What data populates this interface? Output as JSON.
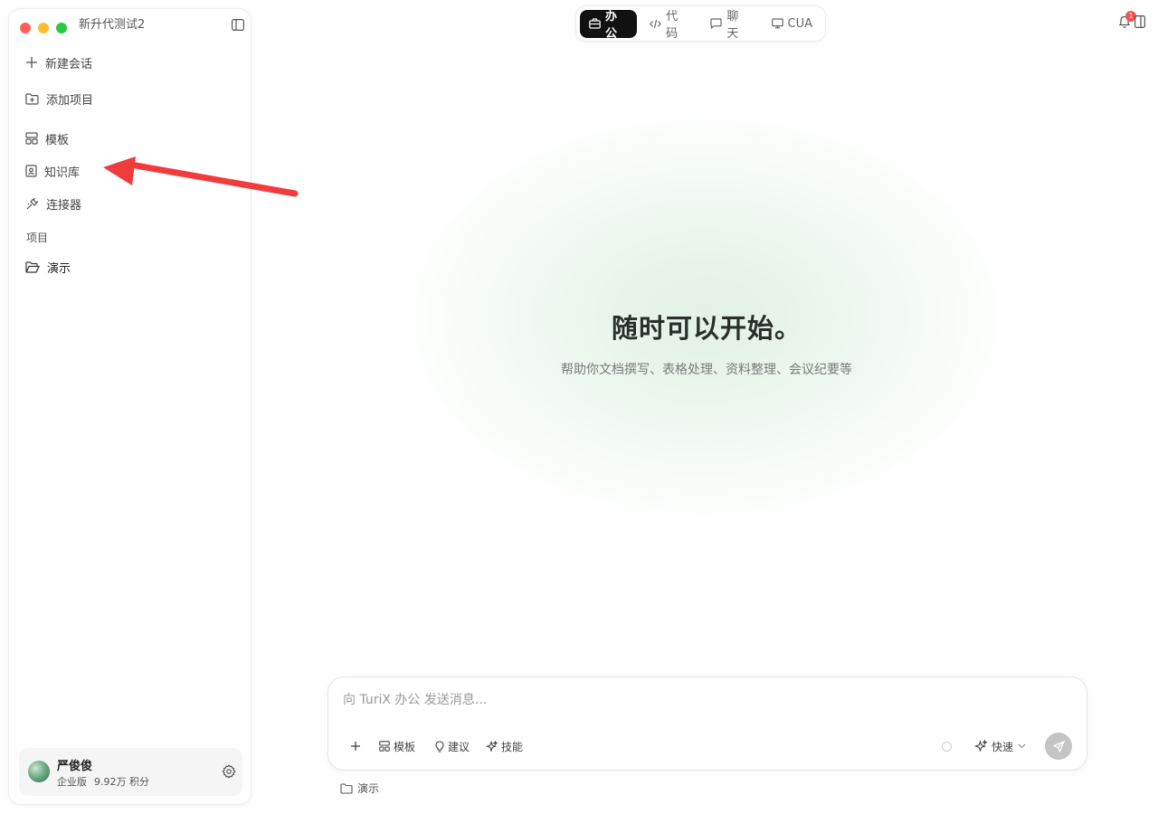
{
  "window": {
    "title": "新升代测试2"
  },
  "sidebar": {
    "items": [
      {
        "label": "新建会话",
        "icon": "plus-icon"
      },
      {
        "label": "添加项目",
        "icon": "folder-plus-icon"
      },
      {
        "label": "模板",
        "icon": "template-icon"
      },
      {
        "label": "知识库",
        "icon": "book-icon"
      },
      {
        "label": "连接器",
        "icon": "plug-icon"
      }
    ],
    "section_label": "项目",
    "projects": [
      {
        "label": "演示",
        "icon": "folder-open-icon"
      }
    ]
  },
  "user": {
    "name": "严俊俊",
    "plan": "企业版",
    "credits": "9.92万 积分"
  },
  "modes": [
    {
      "label": "办公",
      "icon": "briefcase-icon",
      "active": true
    },
    {
      "label": "代码",
      "icon": "code-icon",
      "active": false
    },
    {
      "label": "聊天",
      "icon": "chat-icon",
      "active": false
    },
    {
      "label": "CUA",
      "icon": "monitor-icon",
      "active": false
    }
  ],
  "notifications": {
    "count": "1"
  },
  "hero": {
    "title": "随时可以开始。",
    "subtitle": "帮助你文档撰写、表格处理、资料整理、会议纪要等"
  },
  "composer": {
    "placeholder": "向 TuriX 办公 发送消息...",
    "value": "",
    "tools": [
      {
        "label": "",
        "icon": "plus-icon"
      },
      {
        "label": "模板",
        "icon": "template-icon"
      },
      {
        "label": "建议",
        "icon": "bulb-icon"
      },
      {
        "label": "技能",
        "icon": "sparkle-icon"
      }
    ],
    "speed_label": "快速"
  },
  "project_chip": {
    "label": "演示"
  },
  "colors": {
    "accent_dark": "#111111",
    "badge_red": "#f05252",
    "annotation_arrow": "#f03c3c",
    "glow_green": "#e1f0e4"
  }
}
